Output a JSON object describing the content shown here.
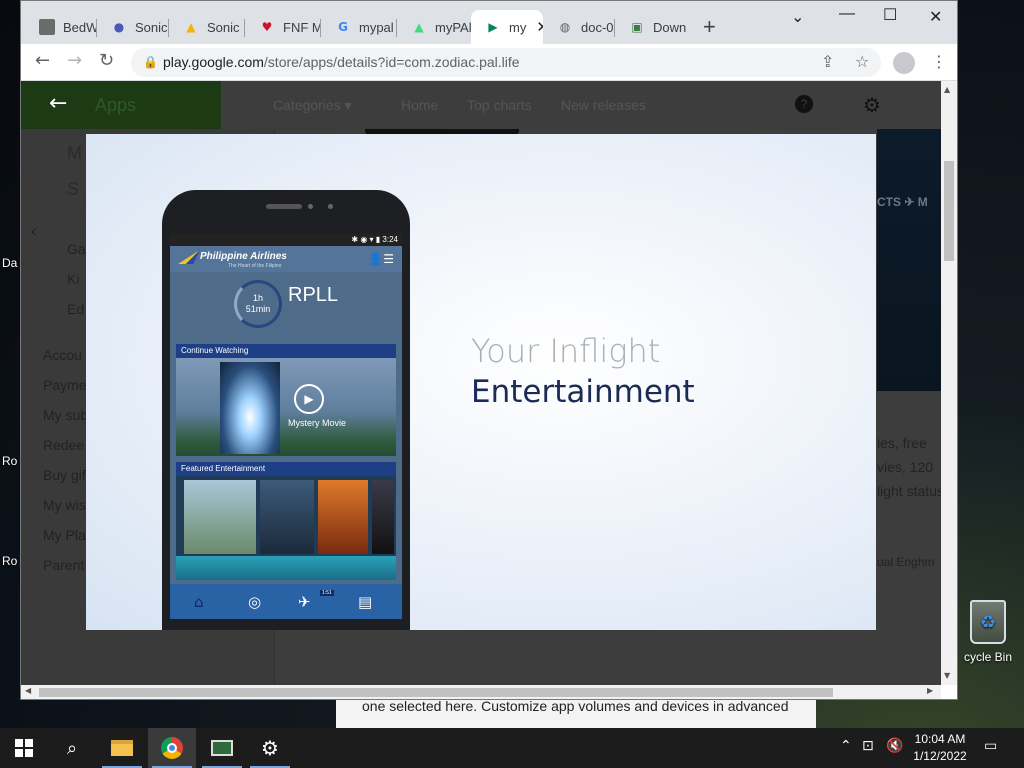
{
  "desktop": {
    "left_labels": [
      "Da",
      "Ro",
      "Ro"
    ],
    "recycle_bin_label": "cycle Bin",
    "behind_window_text": "one selected here. Customize app volumes and devices in advanced"
  },
  "browser": {
    "tabs": [
      {
        "title": "BedW",
        "icon": "page-icon"
      },
      {
        "title": "Sonic",
        "icon": "sonic-icon"
      },
      {
        "title": "Sonic",
        "icon": "drive-icon"
      },
      {
        "title": "FNF M",
        "icon": "heart-icon"
      },
      {
        "title": "mypal",
        "icon": "google-icon"
      },
      {
        "title": "myPAl",
        "icon": "android-icon"
      },
      {
        "title": "my",
        "icon": "play-store-icon",
        "active": true
      },
      {
        "title": "doc-0",
        "icon": "globe-icon"
      },
      {
        "title": "Down",
        "icon": "monitor-icon"
      }
    ],
    "url_host": "play.google.com",
    "url_path": "/store/apps/details?id=com.zodiac.pal.life"
  },
  "play_store": {
    "section": "Apps",
    "nav": [
      "Categories",
      "Home",
      "Top charts",
      "New releases"
    ],
    "sidebar_top": [
      "M",
      "S"
    ],
    "sidebar_categories": [
      "Ga",
      "Ki",
      "Ed"
    ],
    "sidebar_account": [
      "Accou",
      "Payme",
      "My sub",
      "Redee",
      "Buy gif",
      "My wis",
      "My Pla",
      "Parent"
    ],
    "right_snippets": [
      "ies, free",
      "vies, 120",
      "light status",
      "ual Enghm"
    ],
    "right_image_text": "CTS  ✈  M"
  },
  "lightbox": {
    "headline_line1": "Your Inflight",
    "headline_line2": "Entertainment",
    "phone": {
      "status_time": "3:24",
      "airline_name": "Philippine Airlines",
      "tagline": "The Heart of the Filipino",
      "timer_hours": "1h",
      "timer_minutes": "51min",
      "airport_code": "RPLL",
      "continue_watching_label": "Continue Watching",
      "movie_title": "Mystery Movie",
      "featured_label": "Featured Entertainment",
      "flight_badge": "1:51"
    }
  },
  "taskbar": {
    "time": "10:04 AM",
    "date": "1/12/2022"
  },
  "colors": {
    "navy_text": "#1b2b55",
    "pal_blue": "#1e3f86",
    "play_green_dim": "#1c3a14"
  }
}
